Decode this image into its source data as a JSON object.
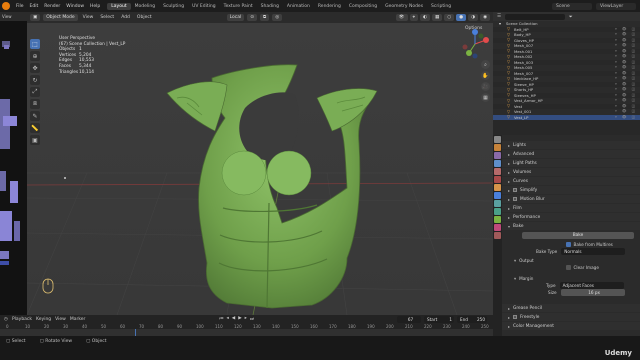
{
  "topbar": {
    "menus": [
      "File",
      "Edit",
      "Render",
      "Window",
      "Help"
    ],
    "workspaces": [
      "Layout",
      "Modeling",
      "Sculpting",
      "UV Editing",
      "Texture Paint",
      "Shading",
      "Animation",
      "Rendering",
      "Compositing",
      "Geometry Nodes",
      "Scripting"
    ],
    "active_workspace": "Layout",
    "scene": "Scene",
    "view_layer": "ViewLayer"
  },
  "left_panel": {
    "view_label": "View"
  },
  "viewport_header": {
    "mode": "Object Mode",
    "menus": [
      "View",
      "Select",
      "Add",
      "Object"
    ],
    "transform": "Local",
    "options": "Options"
  },
  "stats": {
    "view_name": "User Perspective",
    "collection": "(67) Scene Collection | Vest_LP",
    "rows": [
      {
        "label": "Objects",
        "value": "1"
      },
      {
        "label": "Vertices",
        "value": "5,204"
      },
      {
        "label": "Edges",
        "value": "10,553"
      },
      {
        "label": "Faces",
        "value": "5,344"
      },
      {
        "label": "Triangles",
        "value": "10,114"
      }
    ]
  },
  "outliner": {
    "items": [
      "Belt_HP",
      "Body_HP",
      "Gloves_HP",
      "Mesh_007",
      "Mesh.001",
      "Mesh.002",
      "Mesh_003",
      "Mesh.005",
      "Mesh_007",
      "Necklace_HP",
      "Sleeve_HP",
      "Shorts_HP",
      "Sleeves_HP",
      "Vest_Armor_HP",
      "Vest",
      "Vest_001",
      "Vest_LP"
    ]
  },
  "properties": {
    "sections_top": [
      "Lights",
      "Advanced",
      "Light Paths",
      "Volumes",
      "Curves",
      "Simplify",
      "Motion Blur",
      "Film",
      "Performance",
      "Bake"
    ],
    "bake_button": "Bake",
    "bake_from_multires": "Bake from Multires",
    "bake_type_label": "Bake Type",
    "bake_type_value": "Normals",
    "output_label": "Output",
    "clear_image": "Clear Image",
    "margin_label": "Margin",
    "type_label": "Type",
    "type_value": "Adjacent Faces",
    "size_label": "Size",
    "size_value": "16 px",
    "sections_bottom": [
      "Grease Pencil",
      "Freestyle",
      "Color Management"
    ]
  },
  "timeline": {
    "menus": [
      "Playback",
      "Keying",
      "View",
      "Marker"
    ],
    "current_frame": "67",
    "start_label": "Start",
    "start_value": "1",
    "end_label": "End",
    "end_value": "250",
    "ruler": [
      "0",
      "10",
      "20",
      "30",
      "40",
      "50",
      "60",
      "70",
      "80",
      "90",
      "100",
      "110",
      "120",
      "130",
      "140",
      "150",
      "160",
      "170",
      "180",
      "190",
      "200",
      "210",
      "220",
      "230",
      "240",
      "250"
    ]
  },
  "statusbar": {
    "items": [
      "Select",
      "Rotate View",
      "Object"
    ],
    "udemy": "Udemy"
  }
}
